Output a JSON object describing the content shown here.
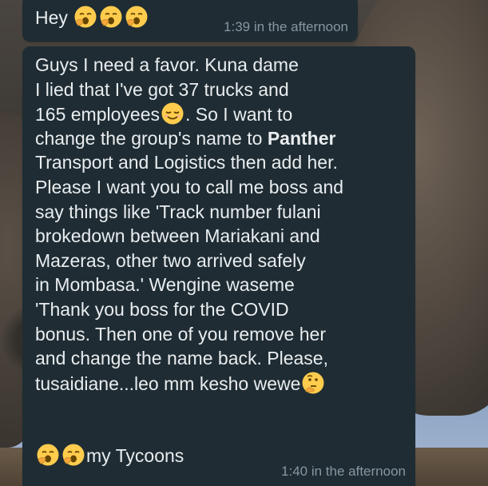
{
  "messages": [
    {
      "text": "Hey",
      "emoji": [
        "yawning-face",
        "yawning-face",
        "yawning-face"
      ],
      "time": "1:39 in the afternoon"
    },
    {
      "lines": [
        "Guys I need a favor. Kuna dame",
        "I lied that I've got 37 trucks and",
        "165 employees",
        ". So I want to",
        "change the group's name to",
        "Panther",
        "Transport and Logistics then add her.",
        "Please I want you to call me boss and",
        "say things like 'Track number fulani",
        "brokedown between Mariakani and",
        "Mazeras, other two arrived safely",
        "in Mombasa.' Wengine waseme",
        "'Thank you boss for the COVID",
        "bonus. Then one of you remove her",
        "and change the name back. Please,",
        "tusaidiane...leo mm kesho wewe",
        "my Tycoons"
      ],
      "emoji": [
        "relieved-face",
        "thinking-face",
        "yawning-face",
        "yawning-face"
      ],
      "time": "1:40 in the afternoon"
    }
  ],
  "colors": {
    "bubble": "#1f2c33",
    "text": "#e9edef",
    "timestamp": "#8696a0",
    "emoji": "#ffcc4d"
  }
}
